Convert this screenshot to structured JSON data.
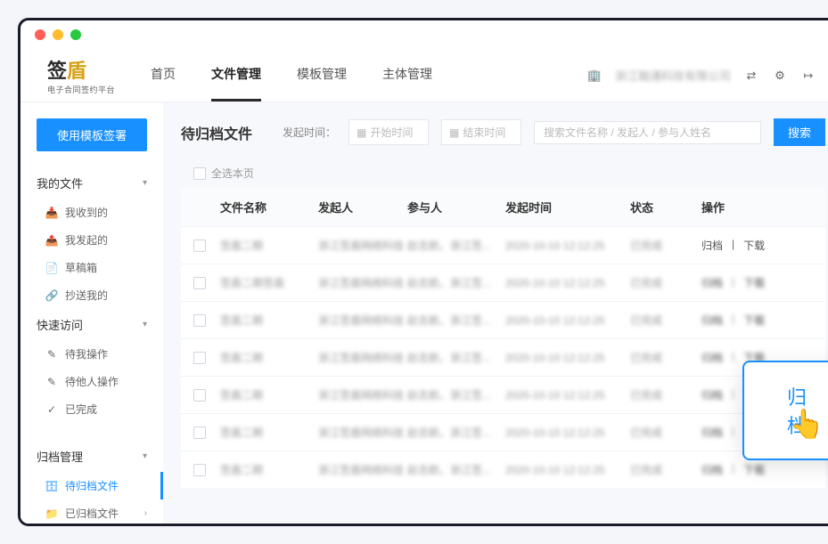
{
  "logo": {
    "text1": "签",
    "text2": "盾",
    "sub": "电子合同签约平台"
  },
  "nav": {
    "home": "首页",
    "files": "文件管理",
    "templates": "模板管理",
    "subjects": "主体管理"
  },
  "header": {
    "company": "浙江融通科技有限公司"
  },
  "sidebar": {
    "use_template": "使用模板签署",
    "my_files": "我的文件",
    "received": "我收到的",
    "initiated": "我发起的",
    "drafts": "草稿箱",
    "cc": "抄送我的",
    "quick": "快速访问",
    "pending_me": "待我操作",
    "pending_others": "待他人操作",
    "completed": "已完成",
    "archive": "归档管理",
    "pending_archive": "待归档文件",
    "archived": "已归档文件"
  },
  "toolbar": {
    "title": "待归档文件",
    "time_label": "发起时间：",
    "start_placeholder": "开始时间",
    "end_placeholder": "结束时间",
    "search_placeholder": "搜索文件名称 / 发起人 / 参与人姓名",
    "search_btn": "搜索",
    "select_all": "全选本页"
  },
  "columns": {
    "name": "文件名称",
    "initiator": "发起人",
    "participant": "参与人",
    "time": "发起时间",
    "status": "状态",
    "action": "操作"
  },
  "actions": {
    "archive": "归档",
    "download": "下载"
  },
  "rows": [
    {
      "name": "签盾二期",
      "initiator": "浙江签盾网络科技",
      "participant": "赵志航、浙江签...",
      "time": "2020-10-10 12:12:25",
      "status": "已完成"
    },
    {
      "name": "签盾二期签盾",
      "initiator": "浙江签盾网络科技",
      "participant": "赵志航、浙江签...",
      "time": "2020-10-10 12:12:25",
      "status": "已完成"
    },
    {
      "name": "签盾二期",
      "initiator": "浙江签盾网络科技",
      "participant": "赵志航、浙江签...",
      "time": "2020-10-10 12:12:25",
      "status": "已完成"
    },
    {
      "name": "签盾二期",
      "initiator": "浙江签盾网络科技",
      "participant": "赵志航、浙江签...",
      "time": "2020-10-10 12:12:25",
      "status": "已完成"
    },
    {
      "name": "签盾二期",
      "initiator": "浙江签盾网络科技",
      "participant": "赵志航、浙江签...",
      "time": "2020-10-10 12:12:25",
      "status": "已完成"
    },
    {
      "name": "签盾二期",
      "initiator": "浙江签盾网络科技",
      "participant": "赵志航、浙江签...",
      "time": "2020-10-10 12:12:25",
      "status": "已完成"
    },
    {
      "name": "签盾二期",
      "initiator": "浙江签盾网络科技",
      "participant": "赵志航、浙江签...",
      "time": "2020-10-10 12:12:25",
      "status": "已完成"
    }
  ],
  "popover": {
    "text": "归档"
  }
}
